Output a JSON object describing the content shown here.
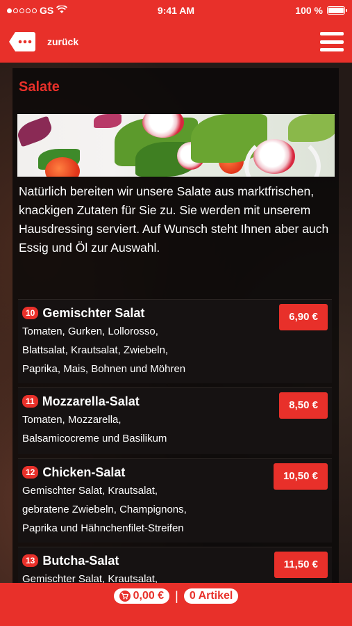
{
  "status_bar": {
    "carrier": "GS",
    "time": "9:41 AM",
    "battery": "100 %",
    "battery_level": 1.0
  },
  "nav": {
    "back_label": "zurück",
    "back_icon": "chat-bubble-dots-icon",
    "menu_icon": "hamburger-icon"
  },
  "section": {
    "title": "Salate",
    "description": "Natürlich bereiten wir unsere Salate aus marktfrischen, knackigen Zutaten für Sie zu. Sie werden mit unserem Hausdressing serviert. Auf Wunsch steht Ihnen aber auch Essig und Öl zur Auswahl."
  },
  "items": [
    {
      "number": "10",
      "name": "Gemischter Salat",
      "desc_lines": [
        "Tomaten, Gurken, Lollorosso,",
        "Blattsalat, Krautsalat, Zwiebeln,",
        "Paprika, Mais, Bohnen und Möhren"
      ],
      "price": "6,90 €"
    },
    {
      "number": "11",
      "name": "Mozzarella-Salat",
      "desc_lines": [
        "Tomaten, Mozzarella,",
        "Balsamicocreme und Basilikum"
      ],
      "price": "8,50 €"
    },
    {
      "number": "12",
      "name": "Chicken-Salat",
      "desc_lines": [
        "Gemischter Salat, Krautsalat,",
        "gebratene Zwiebeln, Champignons,",
        "Paprika und Hähnchenfilet-Streifen"
      ],
      "price": "10,50 €"
    },
    {
      "number": "13",
      "name": "Butcha-Salat",
      "desc_lines": [
        "Gemischter Salat, Krautsalat,"
      ],
      "price": "11,50 €"
    }
  ],
  "footer": {
    "cart_total": "0,00 €",
    "separator": "|",
    "article_count": "0 Artikel"
  },
  "colors": {
    "accent": "#e8302a",
    "panel": "#161212"
  }
}
